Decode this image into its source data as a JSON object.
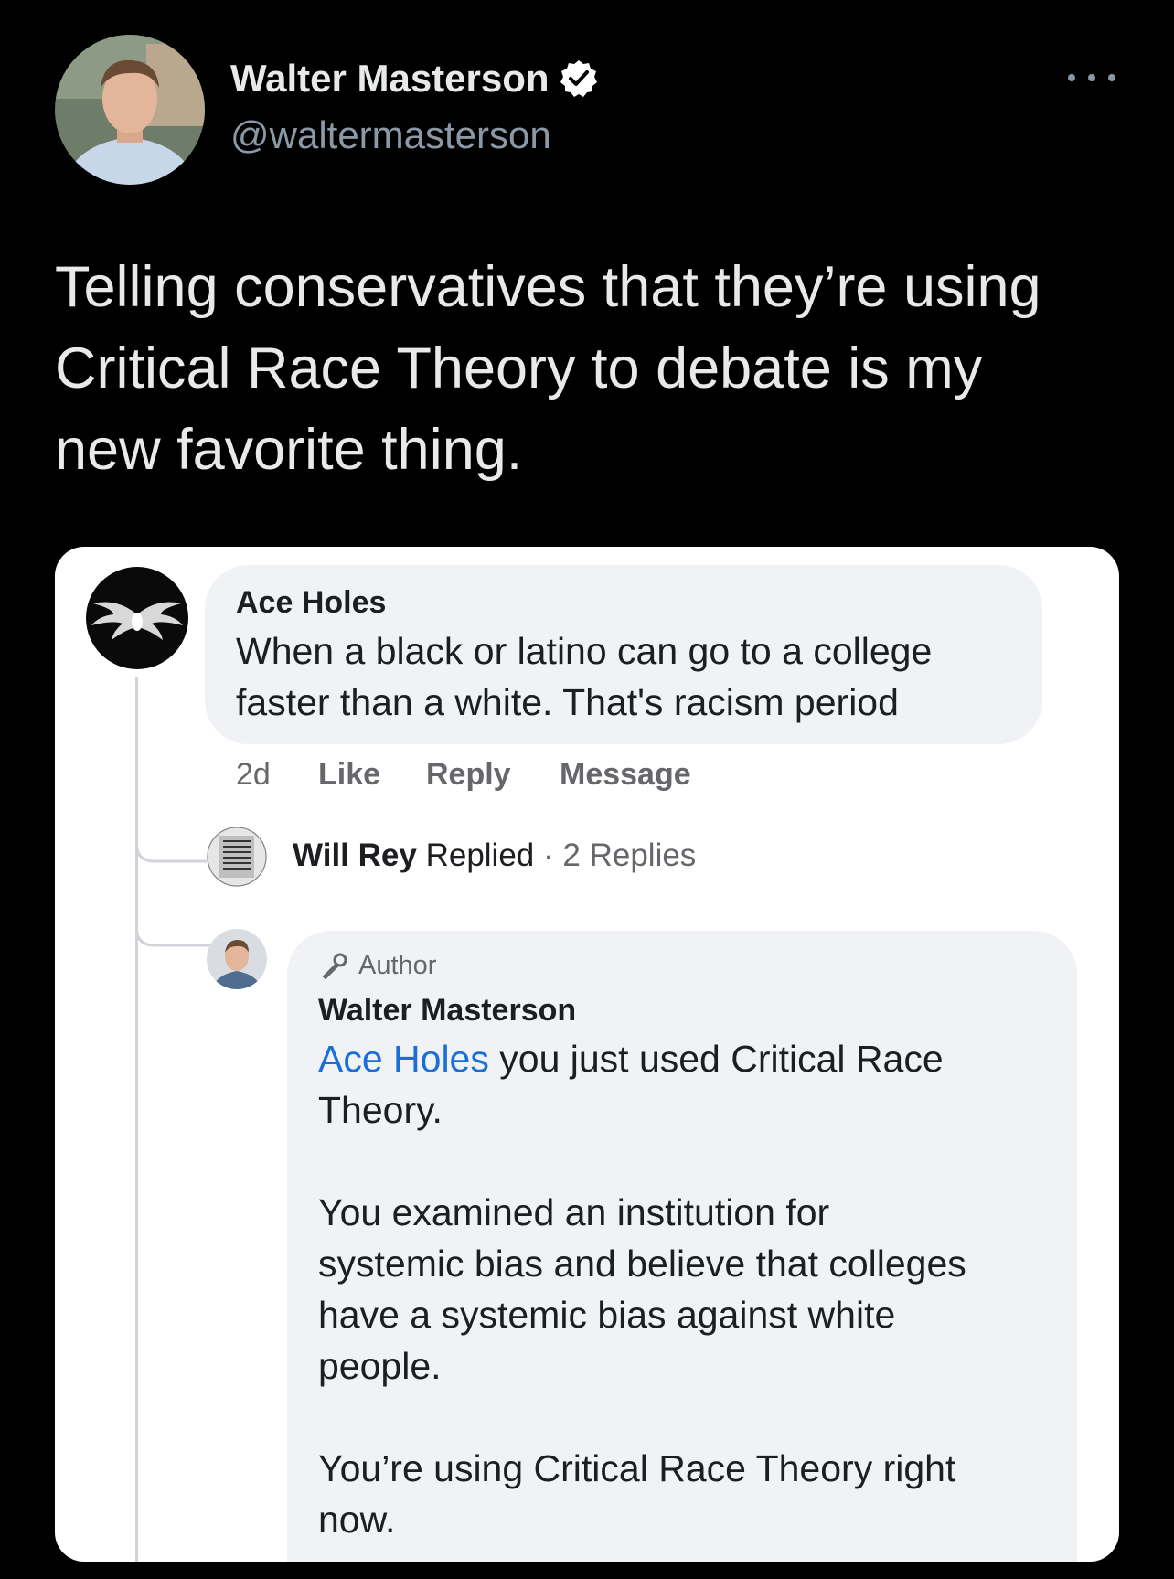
{
  "tweet": {
    "display_name": "Walter Masterson",
    "handle": "@waltermasterson",
    "text": "Telling conservatives that they’re using\nCritical Race Theory to debate is my\nnew favorite thing.",
    "verified_icon": "verified-badge-icon",
    "more_icon": "more-options-icon"
  },
  "embedded_image": {
    "comment1": {
      "author": "Ace Holes",
      "text": "When a black or latino can go to a college\nfaster than a white. That's racism period",
      "time": "2d",
      "like": "Like",
      "reply": "Reply",
      "message": "Message"
    },
    "replied_row": {
      "name": "Will Rey",
      "label": "Replied",
      "count": "· 2 Replies"
    },
    "comment2": {
      "badge": "Author",
      "author": "Walter Masterson",
      "mention": "Ace Holes",
      "text": " you just used Critical Race\nTheory.\n\nYou examined an institution for\nsystemic bias and believe that colleges\nhave a systemic bias against white\npeople.\n\nYou’re using Critical Race Theory right\nnow."
    }
  },
  "colors": {
    "background": "#000000",
    "primary_text": "#e7e9ea",
    "secondary_text": "#8b98a5",
    "verified": "#ffffff",
    "link_blue": "#1a6ed8",
    "bubble": "#f0f2f5"
  }
}
